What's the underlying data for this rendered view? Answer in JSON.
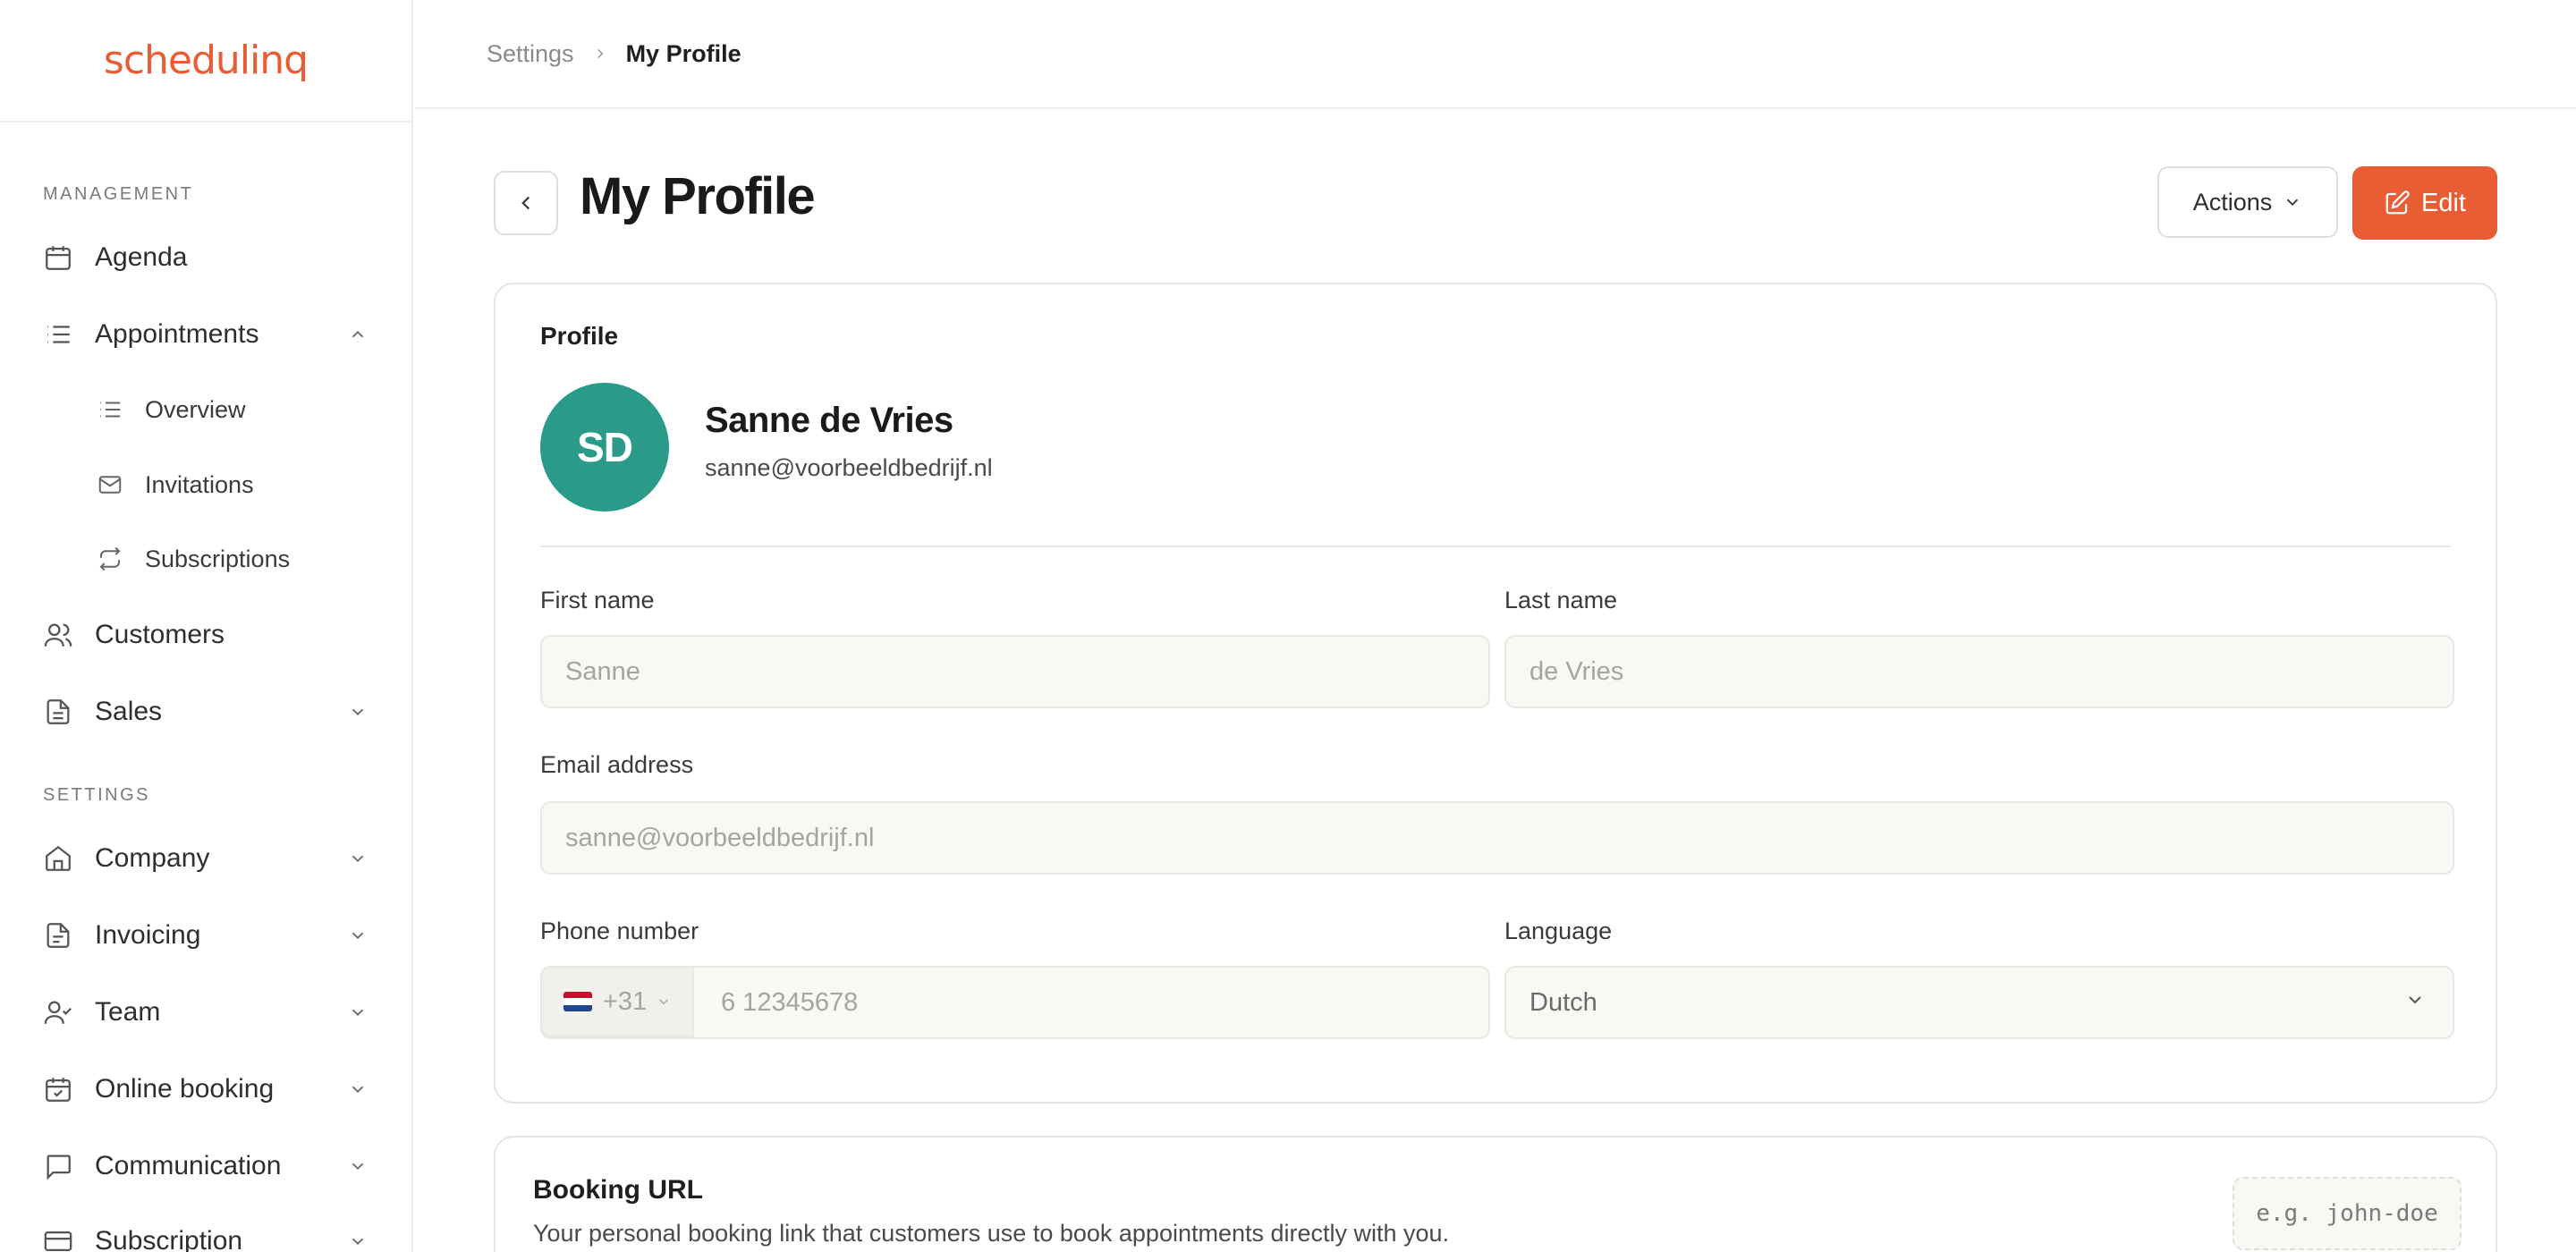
{
  "app": {
    "logo_text": "schedulinq",
    "brand_color": "#e85d33"
  },
  "sidebar": {
    "management_label": "MANAGEMENT",
    "settings_label": "SETTINGS",
    "items": {
      "agenda": "Agenda",
      "appointments": "Appointments",
      "overview": "Overview",
      "invitations": "Invitations",
      "subscriptions": "Subscriptions",
      "customers": "Customers",
      "sales": "Sales",
      "company": "Company",
      "invoicing": "Invoicing",
      "team": "Team",
      "online_booking": "Online booking",
      "communication": "Communication",
      "subscription": "Subscription"
    }
  },
  "breadcrumb": {
    "parent": "Settings",
    "current": "My Profile"
  },
  "header": {
    "title": "My Profile",
    "actions_label": "Actions",
    "edit_label": "Edit"
  },
  "profile": {
    "section_title": "Profile",
    "initials": "SD",
    "avatar_color": "#2a9a89",
    "name": "Sanne de Vries",
    "email": "sanne@voorbeeldbedrijf.nl",
    "fields": {
      "first_name_label": "First name",
      "first_name_value": "Sanne",
      "last_name_label": "Last name",
      "last_name_value": "de Vries",
      "email_label": "Email address",
      "email_value": "sanne@voorbeeldbedrijf.nl",
      "phone_label": "Phone number",
      "phone_prefix": "+31",
      "phone_placeholder": "6 12345678",
      "language_label": "Language",
      "language_value": "Dutch"
    }
  },
  "booking": {
    "title": "Booking URL",
    "description": "Your personal booking link that customers use to book appointments directly with you.",
    "slug_placeholder": "e.g. john-doe"
  }
}
